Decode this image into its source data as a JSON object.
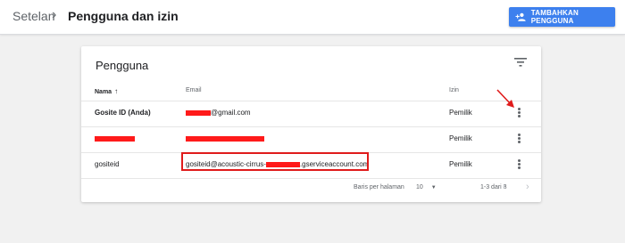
{
  "header": {
    "breadcrumb_root": "Setelan",
    "breadcrumb_separator": "›",
    "page_title": "Pengguna dan izin",
    "add_user_label": "TAMBAHKAN PENGGUNA",
    "add_user_icon": "add-person-icon",
    "accent_color": "#3d80ee"
  },
  "card": {
    "title": "Pengguna",
    "filter_icon": "filter-icon",
    "columns": {
      "name": "Nama",
      "email": "Email",
      "permission": "Izin"
    },
    "sort_arrow": "↑",
    "rows": [
      {
        "name": "Gosite ID (Anda)",
        "email_suffix": "@gmail.com",
        "permission": "Pemilik"
      },
      {
        "name": "",
        "email_suffix": "",
        "permission": "Pemilik"
      },
      {
        "name": "gositeid",
        "email_prefix": "gositeid@acoustic-cirrus-",
        "email_suffix": ".gserviceaccount.com",
        "permission": "Pemilik"
      }
    ],
    "footer": {
      "rows_per_page_label": "Baris per halaman",
      "rows_per_page_value": "10",
      "range": "1-3 dari 3",
      "prev_icon": "chevron-left-icon",
      "next_icon": "chevron-right-icon"
    }
  },
  "annotation_color": "#e01b1b",
  "redaction_color": "#ff1a1a"
}
